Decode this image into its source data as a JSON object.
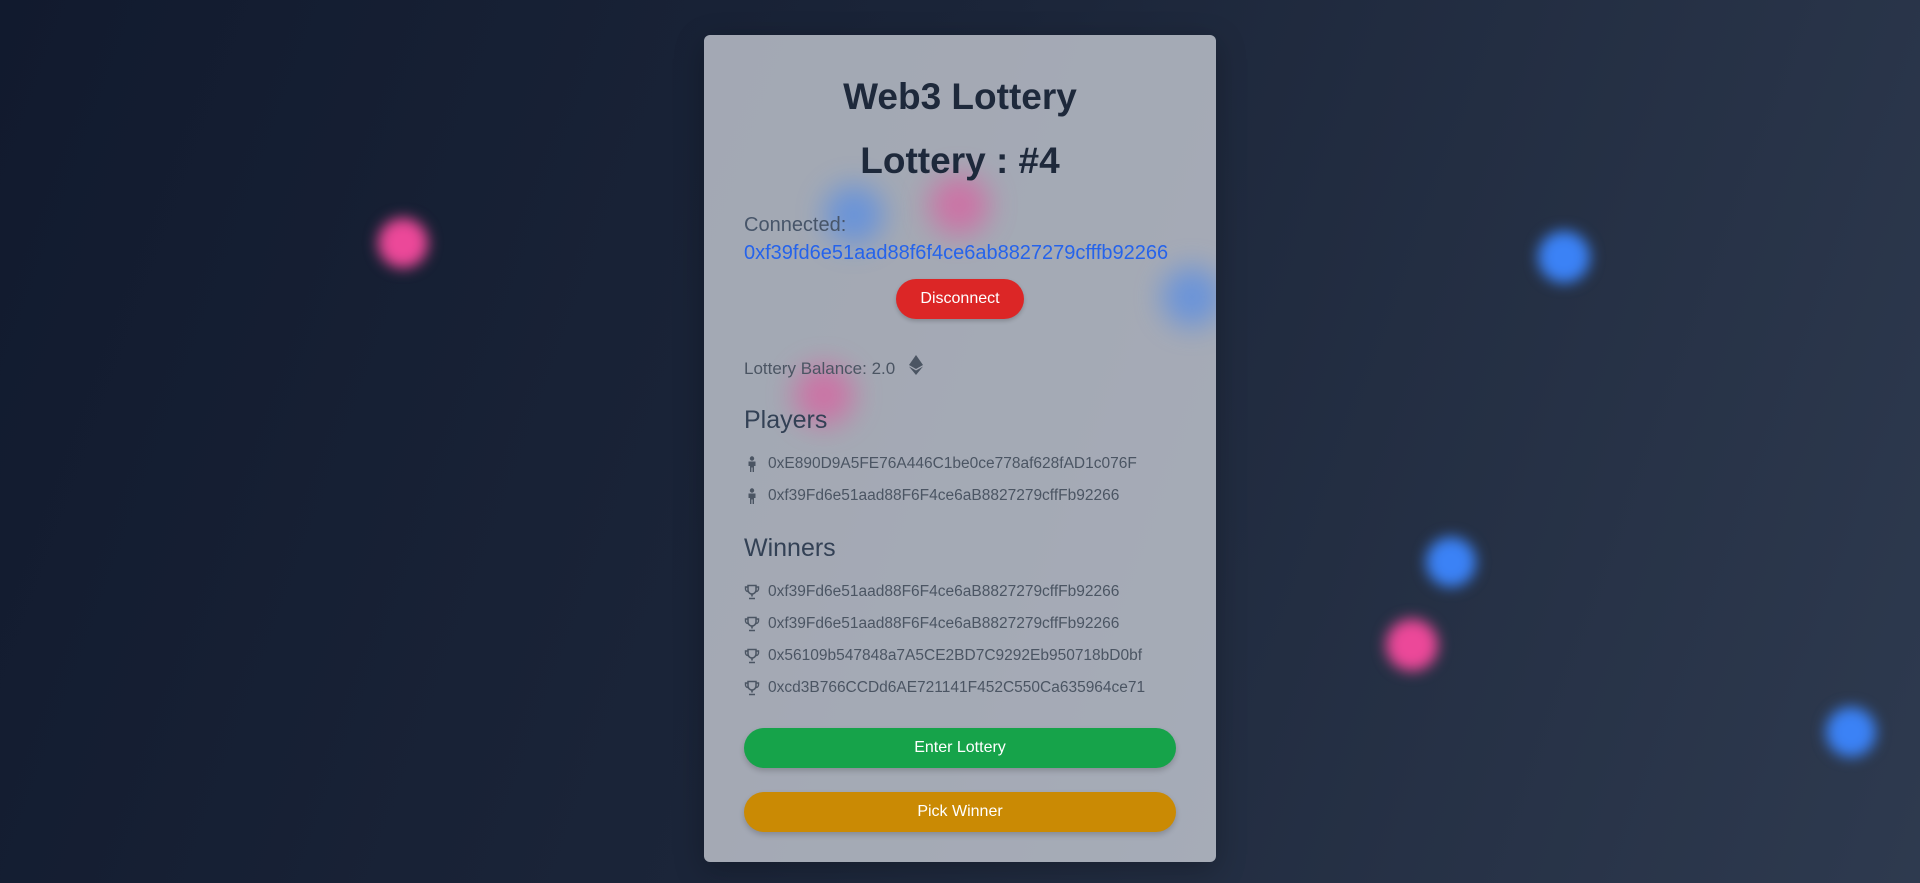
{
  "app": {
    "title": "Web3 Lottery",
    "lottery_label": "Lottery : #4"
  },
  "wallet": {
    "connected_label": "Connected:",
    "address": "0xf39fd6e51aad88f6f4ce6ab8827279cfffb92266",
    "disconnect_label": "Disconnect"
  },
  "balance": {
    "text": "Lottery Balance: 2.0",
    "icon": "ethereum-icon"
  },
  "players": {
    "heading": "Players",
    "icon": "person-icon",
    "items": [
      "0xE890D9A5FE76A446C1be0ce778af628fAD1c076F",
      "0xf39Fd6e51aad88F6F4ce6aB8827279cffFb92266"
    ]
  },
  "winners": {
    "heading": "Winners",
    "icon": "trophy-icon",
    "items": [
      "0xf39Fd6e51aad88F6F4ce6aB8827279cffFb92266",
      "0xf39Fd6e51aad88F6F4ce6aB8827279cffFb92266",
      "0x56109b547848a7A5CE2BD7C9292Eb950718bD0bf",
      "0xcd3B766CCDd6AE721141F452C550Ca635964ce71"
    ]
  },
  "actions": {
    "enter_label": "Enter Lottery",
    "pick_label": "Pick Winner"
  },
  "colors": {
    "accent_blue": "#2563eb",
    "disconnect_red": "#dc2626",
    "enter_green": "#16a34a",
    "pick_amber": "#ca8a04",
    "orb_pink": "#ec4899",
    "orb_blue": "#3b82f6"
  }
}
